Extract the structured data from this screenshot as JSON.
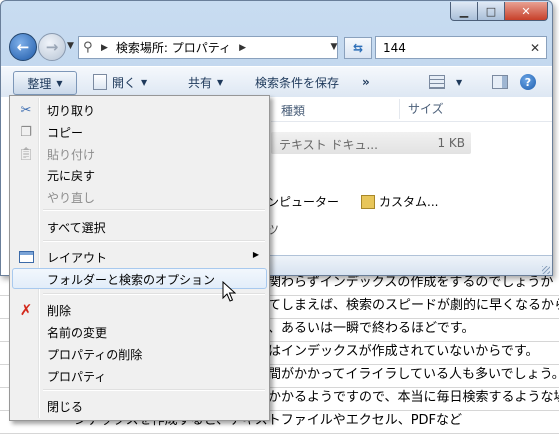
{
  "window": {
    "address_text": "検索場所: プロパティ",
    "search_value": "144"
  },
  "toolbar": {
    "organize_label": "整理",
    "open_label": "開く",
    "share_label": "共有",
    "save_search_label": "検索条件を保存",
    "more_label": "»"
  },
  "content": {
    "col_type": "種類",
    "col_size": "サイズ",
    "file_type": "テキスト ドキュ...",
    "file_size": "1 KB",
    "computer_label": "ンピューター",
    "custom_label": "カスタム...",
    "partial_label": "ツ"
  },
  "menu": {
    "items": [
      {
        "label": "切り取り",
        "icon": "scissors-icon",
        "disabled": false
      },
      {
        "label": "コピー",
        "icon": "copy-icon",
        "disabled": false
      },
      {
        "label": "貼り付け",
        "icon": "paste-icon",
        "disabled": true
      },
      {
        "label": "元に戻す",
        "icon": "",
        "disabled": false
      },
      {
        "label": "やり直し",
        "icon": "",
        "disabled": true
      },
      {
        "label": "すべて選択",
        "icon": "",
        "disabled": false
      },
      {
        "label": "レイアウト",
        "icon": "layout-icon",
        "disabled": false,
        "submenu": true
      },
      {
        "label": "フォルダーと検索のオプション",
        "icon": "",
        "disabled": false,
        "highlighted": true
      },
      {
        "label": "削除",
        "icon": "delete-icon",
        "disabled": false
      },
      {
        "label": "名前の変更",
        "icon": "",
        "disabled": false
      },
      {
        "label": "プロパティの削除",
        "icon": "",
        "disabled": false
      },
      {
        "label": "プロパティ",
        "icon": "",
        "disabled": false
      },
      {
        "label": "閉じる",
        "icon": "",
        "disabled": false
      }
    ]
  },
  "document": {
    "lines": [
      "関わらずインデックスの作成をするのでしょうか",
      "てしまえば、検索のスピードが劇的に早くなるから",
      "、あるいは一瞬で終わるほどです。",
      "はインデックスが作成されていないからです。",
      "間がかかってイライラしている人も多いでしょう。そ",
      "かかるようですので、本当に毎日検索するような場",
      "ンデックスを作成すると、テキストファイルやエクセル、PDFなど"
    ]
  }
}
